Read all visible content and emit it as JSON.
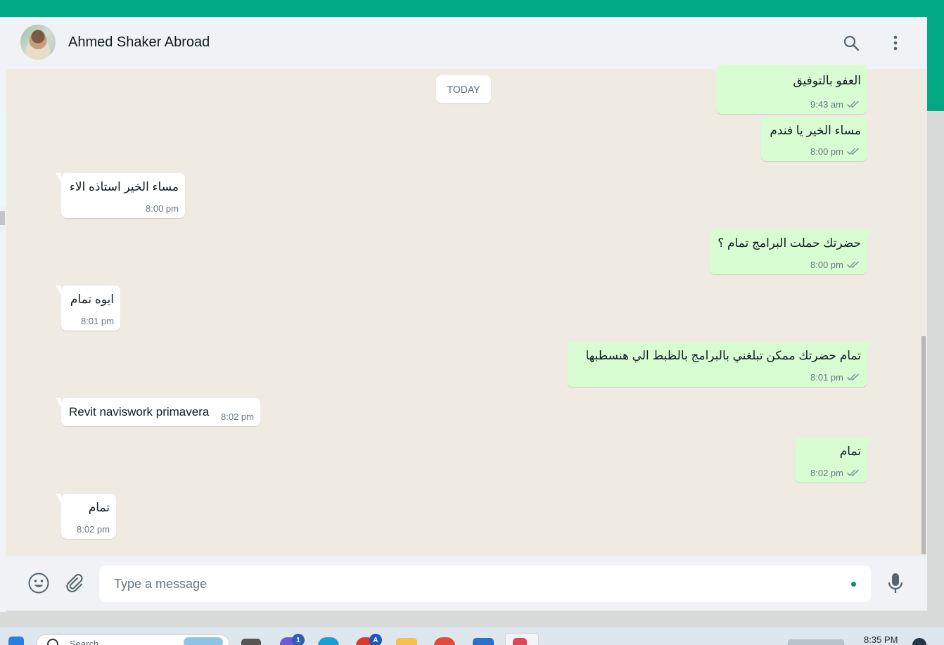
{
  "header": {
    "contact_name": "Ahmed Shaker Abroad",
    "avatar_icon": "contact-avatar",
    "search_icon": "search-icon",
    "menu_icon": "kebab-menu-icon"
  },
  "chat": {
    "date_chip": "TODAY",
    "messages": [
      {
        "direction": "outgoing",
        "text": "العفو بالتوفيق",
        "time": "9:43 am",
        "status": "read-double-check"
      },
      {
        "direction": "outgoing",
        "text": "مساء الخير يا فندم",
        "time": "8:00 pm",
        "status": "read-double-check"
      },
      {
        "direction": "incoming",
        "text": "مساء الخير استاذه الاء",
        "time": "8:00 pm"
      },
      {
        "direction": "outgoing",
        "text": "حضرتك حملت البرامج تمام ؟",
        "time": "8:00 pm",
        "status": "read-double-check"
      },
      {
        "direction": "incoming",
        "text": "ايوه تمام",
        "time": "8:01 pm"
      },
      {
        "direction": "outgoing",
        "text": "تمام حضرتك ممكن تبلغني بالبرامج بالظبط الي هنسطبها",
        "time": "8:01 pm",
        "status": "read-double-check"
      },
      {
        "direction": "incoming",
        "text": "Revit naviswork primavera",
        "time": "8:02 pm"
      },
      {
        "direction": "outgoing",
        "text": "تمام",
        "time": "8:02 pm",
        "status": "read-double-check"
      },
      {
        "direction": "incoming",
        "text": "تمام",
        "time": "8:02 pm"
      }
    ]
  },
  "composer": {
    "placeholder": "Type a message",
    "emoji_icon": "emoji-icon",
    "attach_icon": "paperclip-icon",
    "mic_icon": "microphone-icon"
  },
  "taskbar": {
    "search_label": "Search",
    "badge_1": "1",
    "badge_2": "A",
    "clock": "8:35 PM"
  },
  "colors": {
    "brand_green": "#00a884",
    "outgoing_bubble": "#d9fdd3",
    "incoming_bubble": "#ffffff",
    "chat_background": "#efeae2",
    "header_background": "#f0f2f5",
    "read_ticks": "#8696a0"
  }
}
